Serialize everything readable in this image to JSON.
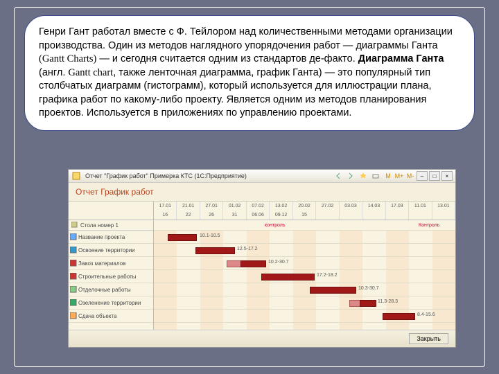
{
  "text": {
    "paragraph_html": "Генри Гант работал вместе с Ф. Тейлором над количественными методами организации производства. Один из методов наглядного упорядочения работ — диаграммы Ганта <span class='serif'>(Gantt Charts)</span> — и сегодня считается одним из стандартов де-факто. <b>Диаграмма Ганта</b> (англ. <span class='serif'>Gantt chart</span>, также ленточная диаграмма, график Ганта) — это популярный тип столбчатых диаграмм (гистограмм), который используется для иллюстрации плана, графика работ по какому-либо проекту. Является одним из методов планирования проектов. Используется в приложениях по управлению проектами."
  },
  "app": {
    "toolbar_title": "Отчет \"График работ\" Примерка КТС (1С:Предприятие)",
    "report_title": "Отчет График работ",
    "top_left_row": "Стола номер 1",
    "tasks": [
      "Название проекта",
      "Освоение территории",
      "Завоз материалов",
      "Строительные работы",
      "Отделочные работы",
      "Озеленение территории",
      "Сдача объекта"
    ],
    "date_top": [
      "17.01",
      "21.01",
      "27.01",
      "01.02",
      "07.02",
      "13.02",
      "20.02",
      "27.02",
      "03.03",
      "14.03",
      "17.03",
      "11.01",
      "13.01"
    ],
    "date_sub": [
      "16",
      "22",
      "26",
      "31",
      "06.06",
      "09.12",
      "15"
    ],
    "chart_labels": {
      "control1": "контроль",
      "control2": "Контроль",
      "l1": "10.1-10.5",
      "l2": "12.5-17.2",
      "l3": "10.2-30.7",
      "l4": "17.2-18.2",
      "l5": "10.3-30.7",
      "l6": "11.3-28.3",
      "l7": "8.4-15.6"
    },
    "footer_btn": "Закрыть"
  }
}
